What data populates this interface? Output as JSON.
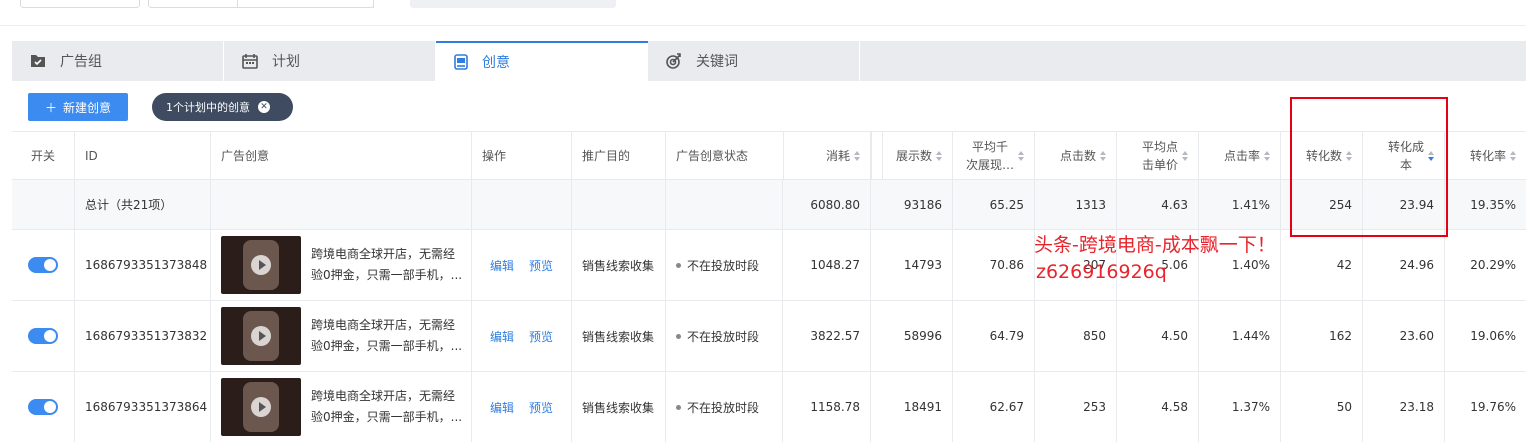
{
  "tabs": [
    {
      "label": "广告组",
      "icon": "folder-check-icon"
    },
    {
      "label": "计划",
      "icon": "calendar-icon"
    },
    {
      "label": "创意",
      "icon": "creative-card-icon"
    },
    {
      "label": "关键词",
      "icon": "target-icon"
    }
  ],
  "toolbar": {
    "new_button": "新建创意",
    "filter_chip": "1个计划中的创意"
  },
  "columns": {
    "switch": "开关",
    "id": "ID",
    "creative": "广告创意",
    "action": "操作",
    "purpose": "推广目的",
    "status": "广告创意状态",
    "cost": "消耗",
    "impressions": "展示数",
    "cpm_1": "平均千",
    "cpm_2": "次展现…",
    "clicks": "点击数",
    "cpc_1": "平均点",
    "cpc_2": "击单价",
    "ctr": "点击率",
    "conversions": "转化数",
    "cost_per_conv_1": "转化成",
    "cost_per_conv_2": "本",
    "conv_rate": "转化率"
  },
  "total": {
    "label": "总计（共21项）",
    "cost": "6080.80",
    "impressions": "93186",
    "cpm": "65.25",
    "clicks": "1313",
    "cpc": "4.63",
    "ctr": "1.41%",
    "conversions": "254",
    "cost_per_conv": "23.94",
    "conv_rate": "19.35%"
  },
  "rows": [
    {
      "id": "1686793351373848",
      "text1": "跨境电商全球开店，无需经",
      "text2": "验0押金，只需一部手机，...",
      "edit": "编辑",
      "preview": "预览",
      "purpose": "销售线索收集",
      "status": "不在投放时段",
      "cost": "1048.27",
      "impressions": "14793",
      "cpm": "70.86",
      "clicks": "207",
      "cpc": "5.06",
      "ctr": "1.40%",
      "conversions": "42",
      "cost_per_conv": "24.96",
      "conv_rate": "20.29%"
    },
    {
      "id": "1686793351373832",
      "text1": "跨境电商全球开店，无需经",
      "text2": "验0押金，只需一部手机，...",
      "edit": "编辑",
      "preview": "预览",
      "purpose": "销售线索收集",
      "status": "不在投放时段",
      "cost": "3822.57",
      "impressions": "58996",
      "cpm": "64.79",
      "clicks": "850",
      "cpc": "4.50",
      "ctr": "1.44%",
      "conversions": "162",
      "cost_per_conv": "23.60",
      "conv_rate": "19.06%"
    },
    {
      "id": "1686793351373864",
      "text1": "跨境电商全球开店，无需经",
      "text2": "验0押金，只需一部手机，...",
      "edit": "编辑",
      "preview": "预览",
      "purpose": "销售线索收集",
      "status": "不在投放时段",
      "cost": "1158.78",
      "impressions": "18491",
      "cpm": "62.67",
      "clicks": "253",
      "cpc": "4.58",
      "ctr": "1.37%",
      "conversions": "50",
      "cost_per_conv": "23.18",
      "conv_rate": "19.76%"
    }
  ],
  "overlay": {
    "line1": "头条-跨境电商-成本飘一下！",
    "line2": "z626916926q",
    "color": "#e8242c"
  },
  "colors": {
    "accent": "#2f7de1",
    "button": "#3b8bf0",
    "chip": "#3e4b60"
  }
}
